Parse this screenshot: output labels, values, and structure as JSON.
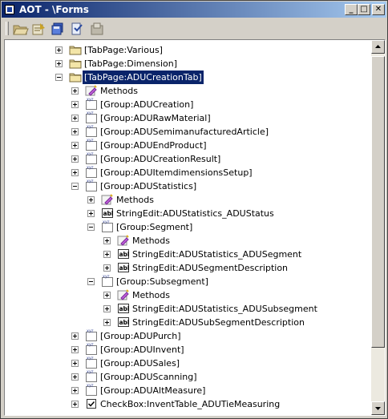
{
  "window": {
    "title": "AOT - \\Forms",
    "minimize": "_",
    "maximize": "□",
    "close": "✕"
  },
  "toolbar": {
    "buttons": [
      "open-folder-icon",
      "properties-icon",
      "save-all-icon",
      "compile-icon",
      "import-icon"
    ]
  },
  "tree": {
    "selected": "[TabPage:ADUCreationTab]",
    "rows": [
      {
        "label": "[TabPage:Various]",
        "level": 0,
        "expander": "plus",
        "icon": "folder-icon"
      },
      {
        "label": "[TabPage:Dimension]",
        "level": 0,
        "expander": "plus",
        "icon": "folder-icon"
      },
      {
        "label": "[TabPage:ADUCreationTab]",
        "level": 0,
        "expander": "minus",
        "icon": "folder-icon",
        "selected": true
      },
      {
        "label": "Methods",
        "level": 1,
        "expander": "plus",
        "icon": "methods-icon"
      },
      {
        "label": "[Group:ADUCreation]",
        "level": 1,
        "expander": "plus",
        "icon": "group-icon"
      },
      {
        "label": "[Group:ADURawMaterial]",
        "level": 1,
        "expander": "plus",
        "icon": "group-icon"
      },
      {
        "label": "[Group:ADUSemimanufacturedArticle]",
        "level": 1,
        "expander": "plus",
        "icon": "group-icon"
      },
      {
        "label": "[Group:ADUEndProduct]",
        "level": 1,
        "expander": "plus",
        "icon": "group-icon"
      },
      {
        "label": "[Group:ADUCreationResult]",
        "level": 1,
        "expander": "plus",
        "icon": "group-icon"
      },
      {
        "label": "[Group:ADUItemdimensionsSetup]",
        "level": 1,
        "expander": "plus",
        "icon": "group-icon"
      },
      {
        "label": "[Group:ADUStatistics]",
        "level": 1,
        "expander": "minus",
        "icon": "group-icon"
      },
      {
        "label": "Methods",
        "level": 2,
        "expander": "plus",
        "icon": "methods-icon"
      },
      {
        "label": "StringEdit:ADUStatistics_ADUStatus",
        "level": 2,
        "expander": "plus",
        "icon": "stringedit-icon"
      },
      {
        "label": "[Group:Segment]",
        "level": 2,
        "expander": "minus",
        "icon": "group-icon"
      },
      {
        "label": "Methods",
        "level": 3,
        "expander": "plus",
        "icon": "methods-icon"
      },
      {
        "label": "StringEdit:ADUStatistics_ADUSegment",
        "level": 3,
        "expander": "plus",
        "icon": "stringedit-icon"
      },
      {
        "label": "StringEdit:ADUSegmentDescription",
        "level": 3,
        "expander": "plus",
        "icon": "stringedit-icon"
      },
      {
        "label": "[Group:Subsegment]",
        "level": 2,
        "expander": "minus",
        "icon": "group-icon"
      },
      {
        "label": "Methods",
        "level": 3,
        "expander": "plus",
        "icon": "methods-icon"
      },
      {
        "label": "StringEdit:ADUStatistics_ADUSubsegment",
        "level": 3,
        "expander": "plus",
        "icon": "stringedit-icon"
      },
      {
        "label": "StringEdit:ADUSubSegmentDescription",
        "level": 3,
        "expander": "plus",
        "icon": "stringedit-icon"
      },
      {
        "label": "[Group:ADUPurch]",
        "level": 1,
        "expander": "plus",
        "icon": "group-icon"
      },
      {
        "label": "[Group:ADUInvent]",
        "level": 1,
        "expander": "plus",
        "icon": "group-icon"
      },
      {
        "label": "[Group:ADUSales]",
        "level": 1,
        "expander": "plus",
        "icon": "group-icon"
      },
      {
        "label": "[Group:ADUScanning]",
        "level": 1,
        "expander": "plus",
        "icon": "group-icon"
      },
      {
        "label": "[Group:ADUAltMeasure]",
        "level": 1,
        "expander": "plus",
        "icon": "group-icon"
      },
      {
        "label": "CheckBox:InventTable_ADUTieMeasuring",
        "level": 1,
        "expander": "plus",
        "icon": "checkbox-icon"
      }
    ]
  },
  "colors": {
    "titlebar_start": "#0a246a",
    "titlebar_end": "#a6caf0",
    "selection": "#0a246a",
    "window_face": "#d4d0c8"
  }
}
